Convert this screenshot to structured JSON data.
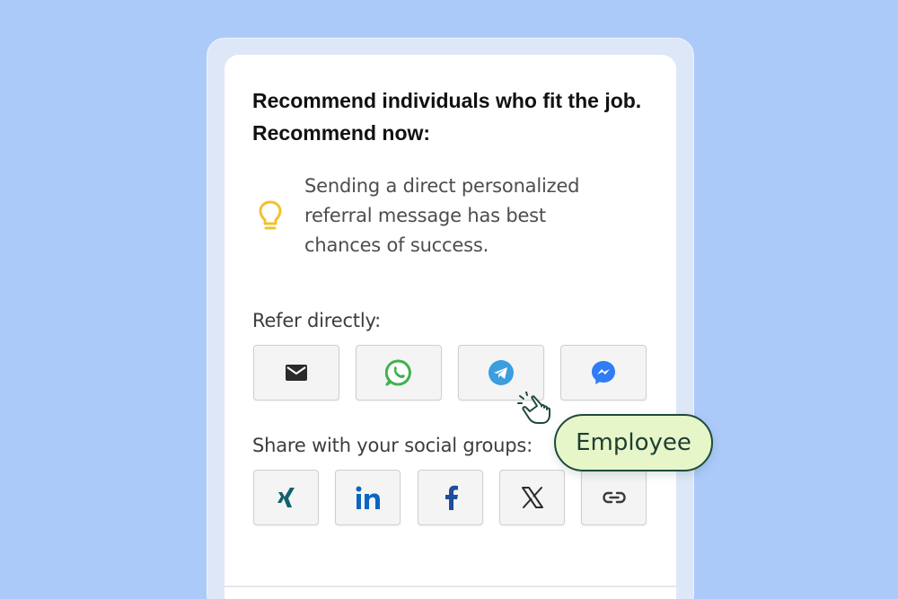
{
  "header": {
    "title": "Recommend individuals who fit the job. Recommend now:"
  },
  "tip": {
    "icon": "lightbulb-icon",
    "text": "Sending a direct personalized referral message has best chances of success."
  },
  "refer": {
    "label": "Refer directly:",
    "buttons": [
      {
        "icon": "email-icon"
      },
      {
        "icon": "whatsapp-icon"
      },
      {
        "icon": "telegram-icon"
      },
      {
        "icon": "messenger-icon"
      }
    ]
  },
  "share": {
    "label": "Share with your social groups:",
    "buttons": [
      {
        "icon": "xing-icon"
      },
      {
        "icon": "linkedin-icon"
      },
      {
        "icon": "facebook-icon"
      },
      {
        "icon": "x-icon"
      },
      {
        "icon": "link-icon"
      }
    ]
  },
  "badge": {
    "label": "Employee"
  },
  "colors": {
    "background": "#abcaf9",
    "bulb": "#f2c12e",
    "whatsapp": "#3fb24f",
    "telegram": "#3a9ee0",
    "messenger": "#2e7cf6",
    "xing": "#13606e",
    "linkedin": "#0b66c2",
    "facebook": "#1f4e9b",
    "badge_bg": "#e7f6c9",
    "badge_border": "#1f4a3b"
  }
}
